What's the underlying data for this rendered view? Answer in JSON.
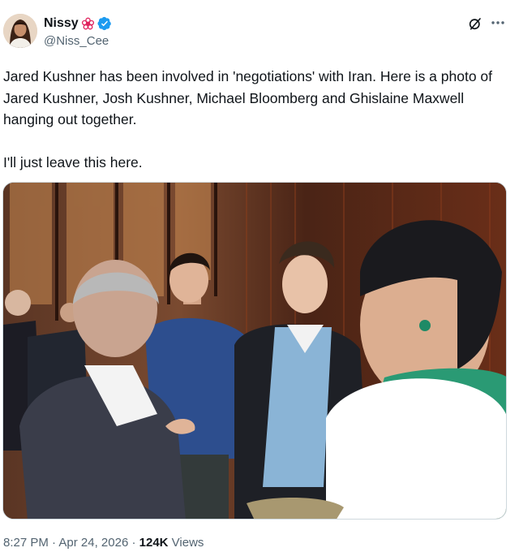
{
  "author": {
    "display_name": "Nissy",
    "handle": "@Niss_Cee",
    "verified": true,
    "verified_color": "#1d9bf0",
    "badge_color": "#e0245e"
  },
  "header_icons": [
    "grok-icon",
    "more-icon"
  ],
  "tweet": {
    "paragraph_1": "Jared Kushner has been involved in 'negotiations' with Iran. Here is a photo of Jared Kushner, Josh Kushner, Michael Bloomberg and Ghislaine Maxwell hanging out together.",
    "paragraph_2": "I'll just leave this here."
  },
  "meta": {
    "time": "8:27 PM",
    "separator_1": " · ",
    "date": "Apr 24, 2026",
    "separator_2": " · ",
    "views_count": "124K",
    "views_label": " Views"
  },
  "colors": {
    "text": "#0f1419",
    "secondary": "#536471",
    "border": "#cfd9de"
  }
}
